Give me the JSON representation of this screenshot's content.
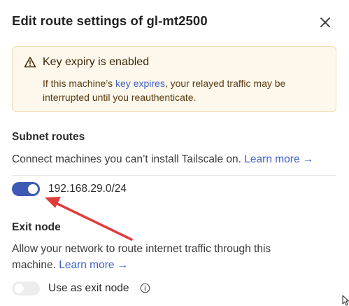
{
  "dialog": {
    "title": "Edit route settings of gl-mt2500",
    "close_icon": "close-icon"
  },
  "warning": {
    "icon": "warning-triangle-icon",
    "title": "Key expiry is enabled",
    "body_prefix": "If this machine’s ",
    "link_text": "key expires",
    "body_suffix": ", your relayed traffic may be interrupted until you reauthenticate.",
    "background_color": "#fef8ec",
    "border_color": "#f4ddb0"
  },
  "subnet_routes": {
    "title": "Subnet routes",
    "description": "Connect machines you can’t install Tailscale on.",
    "learn_more": "Learn more →",
    "routes": [
      {
        "cidr": "192.168.29.0/24",
        "enabled": true
      }
    ]
  },
  "exit_node": {
    "title": "Exit node",
    "description": "Allow your network to route internet traffic through this machine.",
    "learn_more": "Learn more →",
    "toggle_label": "Use as exit node",
    "enabled": false,
    "info_icon": "info-icon"
  },
  "colors": {
    "accent": "#3d5bb4",
    "link": "#3f62c6",
    "annotation_arrow": "#e03c3c"
  }
}
